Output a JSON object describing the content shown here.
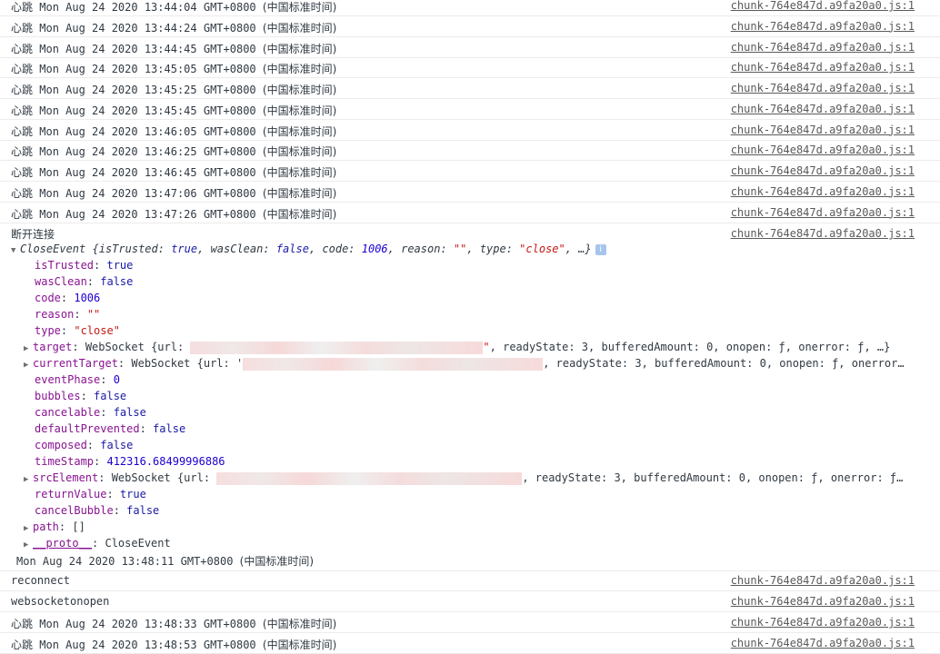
{
  "logs_top": [
    {
      "prefix": "心跳",
      "time": "Mon Aug 24 2020 13:44:04 GMT+0800",
      "tz": "(中国标准时间)",
      "source": "chunk-764e847d.a9fa20a0.js:1"
    },
    {
      "prefix": "心跳",
      "time": "Mon Aug 24 2020 13:44:24 GMT+0800",
      "tz": "(中国标准时间)",
      "source": "chunk-764e847d.a9fa20a0.js:1"
    },
    {
      "prefix": "心跳",
      "time": "Mon Aug 24 2020 13:44:45 GMT+0800",
      "tz": "(中国标准时间)",
      "source": "chunk-764e847d.a9fa20a0.js:1"
    },
    {
      "prefix": "心跳",
      "time": "Mon Aug 24 2020 13:45:05 GMT+0800",
      "tz": "(中国标准时间)",
      "source": "chunk-764e847d.a9fa20a0.js:1"
    },
    {
      "prefix": "心跳",
      "time": "Mon Aug 24 2020 13:45:25 GMT+0800",
      "tz": "(中国标准时间)",
      "source": "chunk-764e847d.a9fa20a0.js:1"
    },
    {
      "prefix": "心跳",
      "time": "Mon Aug 24 2020 13:45:45 GMT+0800",
      "tz": "(中国标准时间)",
      "source": "chunk-764e847d.a9fa20a0.js:1"
    },
    {
      "prefix": "心跳",
      "time": "Mon Aug 24 2020 13:46:05 GMT+0800",
      "tz": "(中国标准时间)",
      "source": "chunk-764e847d.a9fa20a0.js:1"
    },
    {
      "prefix": "心跳",
      "time": "Mon Aug 24 2020 13:46:25 GMT+0800",
      "tz": "(中国标准时间)",
      "source": "chunk-764e847d.a9fa20a0.js:1"
    },
    {
      "prefix": "心跳",
      "time": "Mon Aug 24 2020 13:46:45 GMT+0800",
      "tz": "(中国标准时间)",
      "source": "chunk-764e847d.a9fa20a0.js:1"
    },
    {
      "prefix": "心跳",
      "time": "Mon Aug 24 2020 13:47:06 GMT+0800",
      "tz": "(中国标准时间)",
      "source": "chunk-764e847d.a9fa20a0.js:1"
    },
    {
      "prefix": "心跳",
      "time": "Mon Aug 24 2020 13:47:26 GMT+0800",
      "tz": "(中国标准时间)",
      "source": "chunk-764e847d.a9fa20a0.js:1"
    }
  ],
  "disconnect": {
    "label": "断开连接",
    "source": "chunk-764e847d.a9fa20a0.js:1"
  },
  "close_event": {
    "header_class": "CloseEvent",
    "header_summary_open": "{",
    "header_props": [
      {
        "k": "isTrusted",
        "v": "true",
        "t": "kw"
      },
      {
        "k": "wasClean",
        "v": "false",
        "t": "kw"
      },
      {
        "k": "code",
        "v": "1006",
        "t": "num"
      },
      {
        "k": "reason",
        "v": "\"\"",
        "t": "str"
      },
      {
        "k": "type",
        "v": "\"close\"",
        "t": "str"
      }
    ],
    "header_tail": ", …}",
    "info_glyph": "i",
    "props": [
      {
        "k": "isTrusted",
        "v": "true",
        "t": "kw"
      },
      {
        "k": "wasClean",
        "v": "false",
        "t": "kw"
      },
      {
        "k": "code",
        "v": "1006",
        "t": "num"
      },
      {
        "k": "reason",
        "v": "\"\"",
        "t": "str"
      },
      {
        "k": "type",
        "v": "\"close\"",
        "t": "str"
      }
    ],
    "target": {
      "k": "target",
      "cls": "WebSocket",
      "open": "{url: ",
      "close_quote": "\"",
      "rest": ", readyState: 3, bufferedAmount: 0, onopen: ƒ, onerror: ƒ, …}"
    },
    "current_target": {
      "k": "currentTarget",
      "cls": "WebSocket",
      "open": "{url: '",
      "rest": ", readyState: 3, bufferedAmount: 0, onopen: ƒ, onerror…"
    },
    "props2": [
      {
        "k": "eventPhase",
        "v": "0",
        "t": "num"
      },
      {
        "k": "bubbles",
        "v": "false",
        "t": "kw"
      },
      {
        "k": "cancelable",
        "v": "false",
        "t": "kw"
      },
      {
        "k": "defaultPrevented",
        "v": "false",
        "t": "kw"
      },
      {
        "k": "composed",
        "v": "false",
        "t": "kw"
      },
      {
        "k": "timeStamp",
        "v": "412316.68499996886",
        "t": "num"
      }
    ],
    "src_element": {
      "k": "srcElement",
      "cls": "WebSocket",
      "open": "{url: ",
      "rest": ", readyState: 3, bufferedAmount: 0, onopen: ƒ, onerror: ƒ…"
    },
    "props3": [
      {
        "k": "returnValue",
        "v": "true",
        "t": "kw"
      },
      {
        "k": "cancelBubble",
        "v": "false",
        "t": "kw"
      }
    ],
    "path": {
      "k": "path",
      "v": "[]"
    },
    "proto": {
      "k": "__proto__",
      "v": "CloseEvent"
    },
    "trailer": "Mon Aug 24 2020 13:48:11 GMT+0800",
    "trailer_tz": "(中国标准时间)"
  },
  "logs_bottom": [
    {
      "text": "reconnect",
      "source": "chunk-764e847d.a9fa20a0.js:1"
    },
    {
      "text": "websocketonopen",
      "source": "chunk-764e847d.a9fa20a0.js:1"
    }
  ],
  "logs_end": [
    {
      "prefix": "心跳",
      "time": "Mon Aug 24 2020 13:48:33 GMT+0800",
      "tz": "(中国标准时间)",
      "source": "chunk-764e847d.a9fa20a0.js:1"
    },
    {
      "prefix": "心跳",
      "time": "Mon Aug 24 2020 13:48:53 GMT+0800",
      "tz": "(中国标准时间)",
      "source": "chunk-764e847d.a9fa20a0.js:1"
    }
  ]
}
